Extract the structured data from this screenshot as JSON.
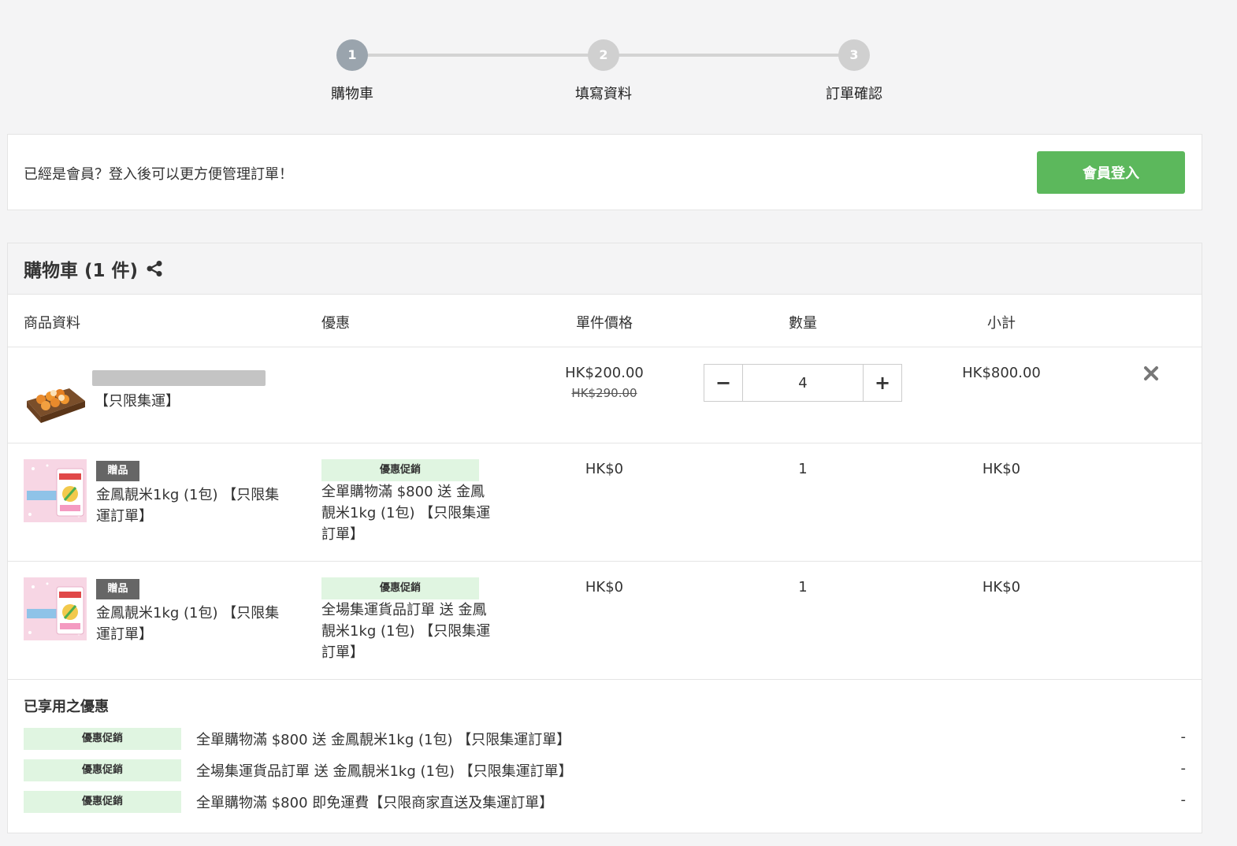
{
  "steps": [
    {
      "number": "1",
      "label": "購物車"
    },
    {
      "number": "2",
      "label": "填寫資料"
    },
    {
      "number": "3",
      "label": "訂單確認"
    }
  ],
  "member": {
    "prompt": "已經是會員？登入後可以更方便管理訂單！",
    "login_label": "會員登入"
  },
  "cart": {
    "title": "購物車 (1 件)",
    "headers": {
      "product": "商品資料",
      "promotion": "優惠",
      "unit_price": "單件價格",
      "quantity": "數量",
      "subtotal": "小計"
    },
    "item": {
      "tag": "【只限集運】",
      "price": "HK$200.00",
      "original_price": "HK$290.00",
      "quantity": "4",
      "minus_label": "−",
      "plus_label": "+",
      "subtotal": "HK$800.00"
    },
    "gifts": [
      {
        "badge": "贈品",
        "name": "金鳳靚米1kg (1包) 【只限集運訂單】",
        "promo_badge": "優惠促銷",
        "promo_desc": "全單購物滿 $800 送 金鳳靚米1kg (1包) 【只限集運訂單】",
        "price": "HK$0",
        "quantity": "1",
        "subtotal": "HK$0"
      },
      {
        "badge": "贈品",
        "name": "金鳳靚米1kg (1包) 【只限集運訂單】",
        "promo_badge": "優惠促銷",
        "promo_desc": "全場集運貨品訂單 送 金鳳靚米1kg (1包) 【只限集運訂單】",
        "price": "HK$0",
        "quantity": "1",
        "subtotal": "HK$0"
      }
    ],
    "applied": {
      "title": "已享用之優惠",
      "items": [
        {
          "badge": "優惠促銷",
          "text": "全單購物滿 $800 送 金鳳靚米1kg (1包) 【只限集運訂單】",
          "value": "-"
        },
        {
          "badge": "優惠促銷",
          "text": "全場集運貨品訂單 送 金鳳靚米1kg (1包) 【只限集運訂單】",
          "value": "-"
        },
        {
          "badge": "優惠促銷",
          "text": "全單購物滿 $800 即免運費【只限商家直送及集運訂單】",
          "value": "-"
        }
      ]
    }
  },
  "colors": {
    "login_button": "#5cb85c",
    "promo_badge_bg": "#e0f5e1",
    "gift_badge_bg": "#666666",
    "active_step": "#9aa4ad",
    "inactive_step": "#d0d0d0"
  }
}
